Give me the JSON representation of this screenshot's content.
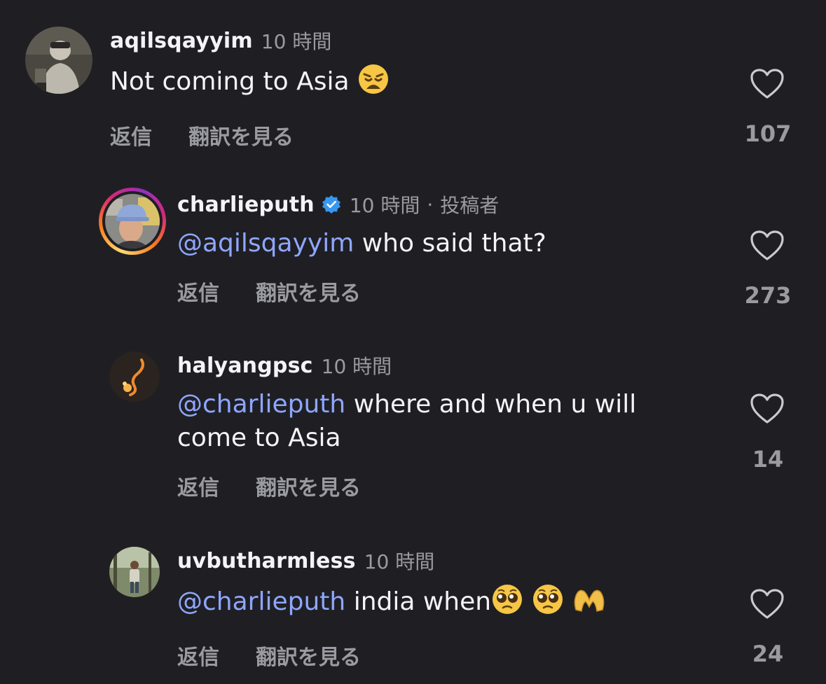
{
  "comments": [
    {
      "username": "aqilsqayyim",
      "time": "10 時間",
      "text": "Not coming to Asia",
      "reply_label": "返信",
      "translate_label": "翻訳を見る",
      "likes": "107"
    },
    {
      "username": "charlieputh",
      "time": "10 時間",
      "separator": "·",
      "author_tag": "投稿者",
      "mention": "@aqilsqayyim",
      "text": "who said that?",
      "reply_label": "返信",
      "translate_label": "翻訳を見る",
      "likes": "273"
    },
    {
      "username": "halyangpsc",
      "time": "10 時間",
      "mention": "@charlieputh",
      "text": "where and when u will come to Asia",
      "reply_label": "返信",
      "translate_label": "翻訳を見る",
      "likes": "14"
    },
    {
      "username": "uvbutharmless",
      "time": "10 時間",
      "mention": "@charlieputh",
      "text": "india when",
      "reply_label": "返信",
      "translate_label": "翻訳を見る",
      "likes": "24"
    }
  ],
  "colors": {
    "background": "#1f1f23",
    "mention": "#8fa6ff",
    "secondary_text": "#9a9aa1",
    "verified": "#3897f0"
  }
}
